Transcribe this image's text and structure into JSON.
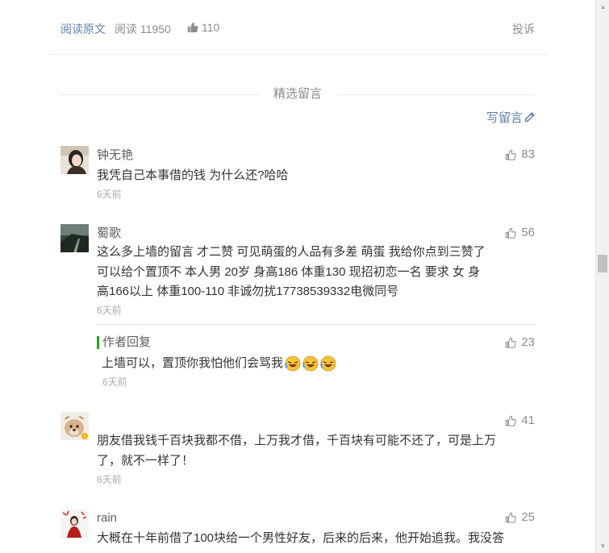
{
  "meta": {
    "read_original": "阅读原文",
    "reads": "阅读 11950",
    "likes": "110",
    "report": "投诉"
  },
  "section": {
    "title": "精选留言",
    "write": "写留言"
  },
  "comments": [
    {
      "nick": "钟无艳",
      "likes": "83",
      "text": "我凭自己本事借的钱 为什么还?哈哈",
      "time": "6天前"
    },
    {
      "nick": "蜀歌",
      "likes": "56",
      "lines": [
        "这么多上墙的留言  才二赞  可见萌蛋的人品有多差  萌蛋  我给你点到三赞了",
        "可以给个置顶不  本人男 20岁  身高186 体重130  现招初恋一名  要求 女 身",
        "高166以上  体重100-110  非诚勿扰17738539332电微同号"
      ],
      "time": "6天前",
      "reply": {
        "label": "作者回复",
        "likes": "23",
        "text": "上墙可以，置顶你我怕他们会骂我",
        "time": "6天前"
      }
    },
    {
      "nick": "",
      "likes": "41",
      "lines": [
        "朋友借我钱千百块我都不借，上万我才借，千百块有可能不还了，可是上万",
        "了，就不一样了！"
      ],
      "time": "6天前"
    },
    {
      "nick": "rain",
      "likes": "25",
      "lines": [
        "大概在十年前借了100块给一个男性好友，后来的后来，他开始追我。我没答"
      ]
    }
  ],
  "colors": {
    "link": "#607fa6",
    "reply_bar": "#1aad19",
    "muted": "#8c8c8c"
  }
}
